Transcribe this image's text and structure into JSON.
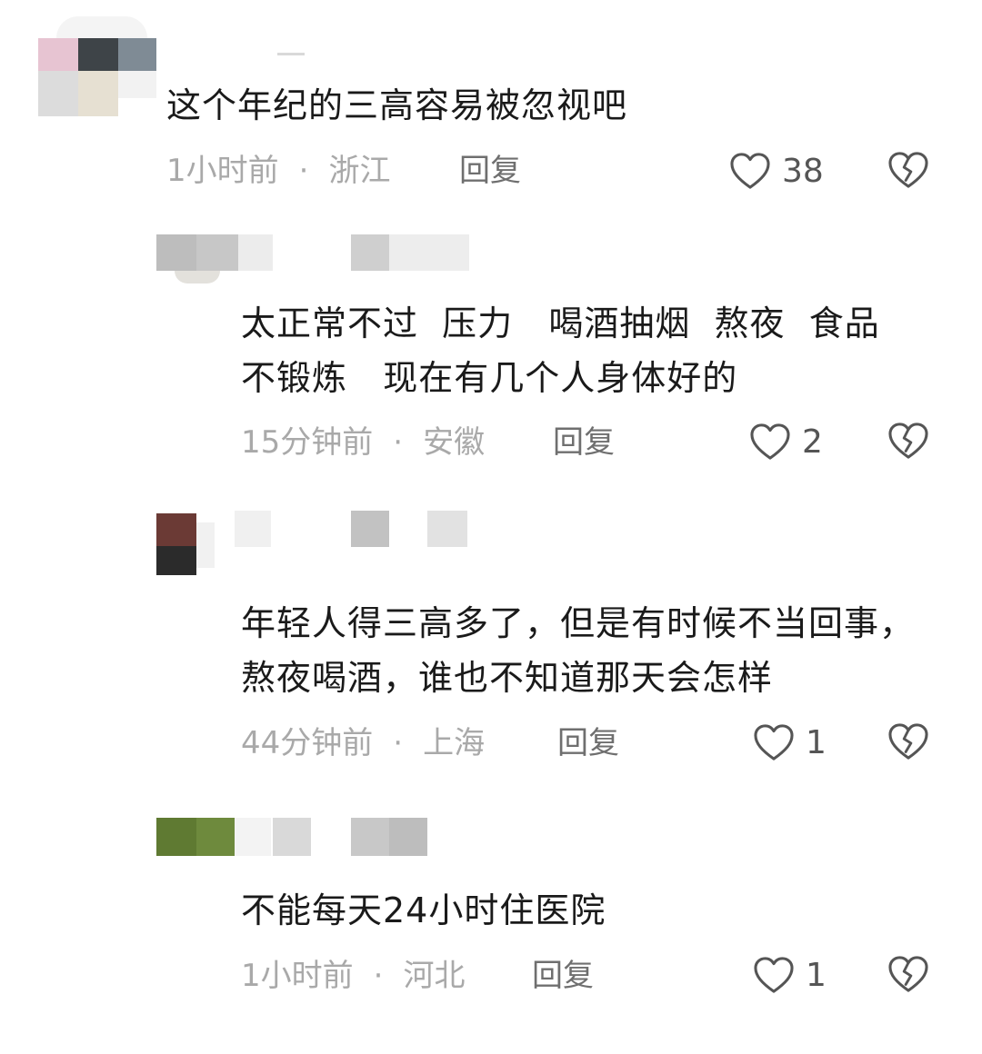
{
  "comments": [
    {
      "text": "这个年纪的三高容易被忽视吧",
      "time": "1小时前",
      "sep": "·",
      "location": "浙江",
      "reply": "回复",
      "likes": "38"
    },
    {
      "text": "太正常不过  压力   喝酒抽烟  熬夜  食品   不锻炼   现在有几个人身体好的",
      "time": "15分钟前",
      "sep": "·",
      "location": "安徽",
      "reply": "回复",
      "likes": "2"
    },
    {
      "text": "年轻人得三高多了，但是有时候不当回事，熬夜喝酒，谁也不知道那天会怎样",
      "time": "44分钟前",
      "sep": "·",
      "location": "上海",
      "reply": "回复",
      "likes": "1"
    },
    {
      "text": "不能每天24小时住医院",
      "time": "1小时前",
      "sep": "·",
      "location": "河北",
      "reply": "回复",
      "likes": "1"
    }
  ],
  "icons": {
    "like": "heart-outline-icon",
    "dislike": "broken-heart-icon"
  },
  "colors": {
    "text": "#1a1a1a",
    "meta": "#a9a9a9",
    "reply": "#6f6f6f",
    "icon": "#555555"
  }
}
